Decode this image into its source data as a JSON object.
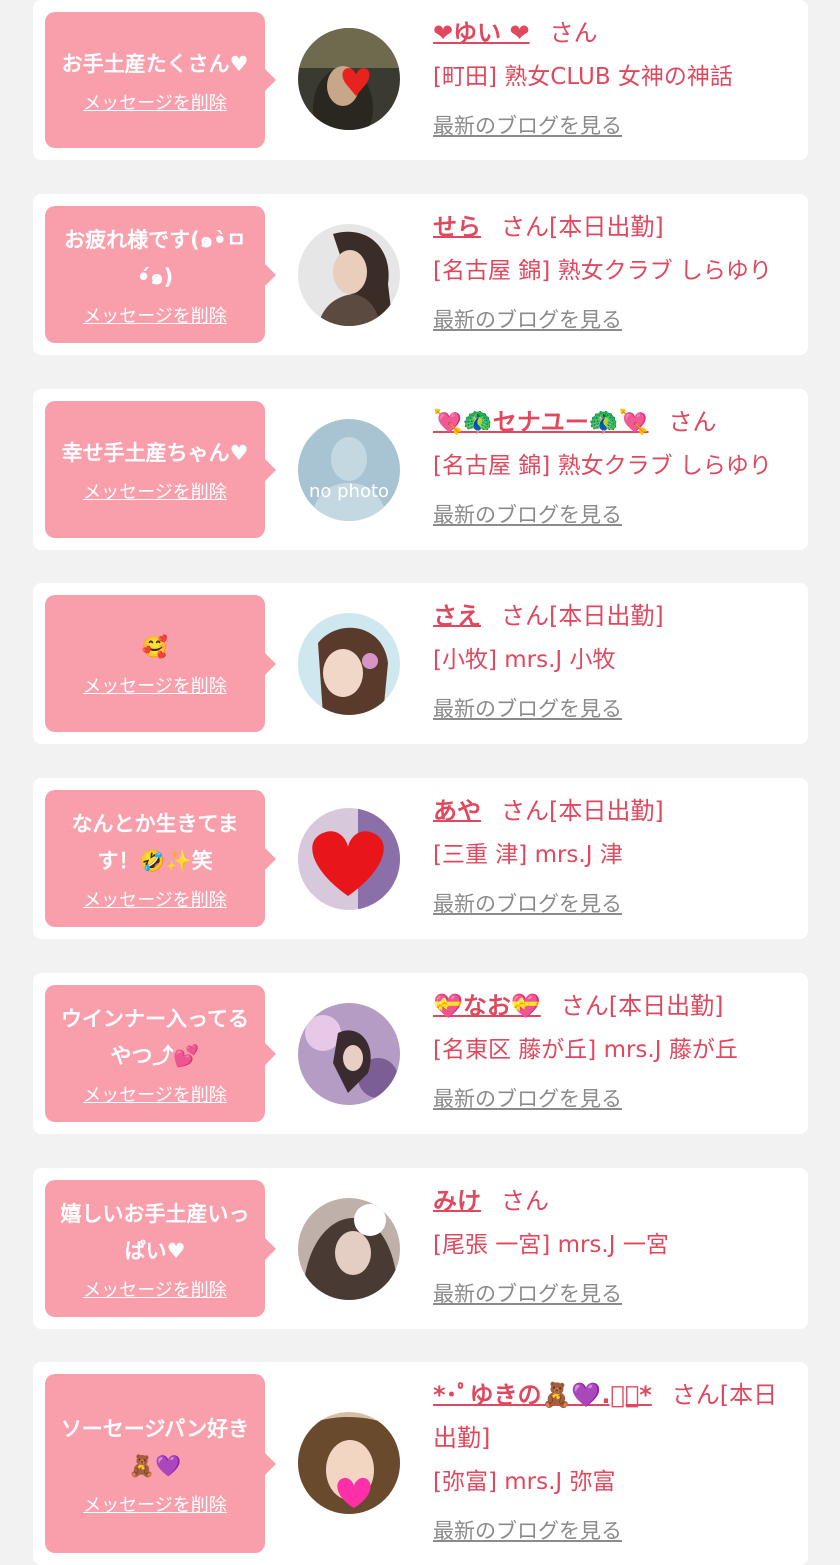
{
  "delete_label": "メッセージを削除",
  "blog_label": "最新のブログを見る",
  "items": [
    {
      "message": "お手土産たくさん♥",
      "name": "❤ゆい ❤",
      "suffix": "さん",
      "shop": "[町田] 熟女CLUB 女神の神話"
    },
    {
      "message": "お疲れ様です(๑•̀ㅁ•́๑)",
      "name": "せら",
      "suffix": "さん[本日出勤]",
      "shop": "[名古屋 錦] 熟女クラブ しらゆり"
    },
    {
      "message": "幸せ手土産ちゃん♥",
      "name": "💘🦚セナユー🦚💘",
      "suffix": "さん",
      "shop": "[名古屋 錦] 熟女クラブ しらゆり"
    },
    {
      "message": "🥰",
      "name": "さえ",
      "suffix": "さん[本日出勤]",
      "shop": "[小牧] mrs.J 小牧"
    },
    {
      "message": "なんとか生きてます！🤣✨笑",
      "name": "あや",
      "suffix": "さん[本日出勤]",
      "shop": "[三重 津] mrs.J 津"
    },
    {
      "message": "ウインナー入ってるやつ⤴💕",
      "name": "💝なお💝",
      "suffix": "さん[本日出勤]",
      "shop": "[名東区 藤が丘] mrs.J 藤が丘"
    },
    {
      "message": "嬉しいお手土産いっぱい♥",
      "name": "みけ",
      "suffix": "さん",
      "shop": "[尾張 一宮] mrs.J 一宮"
    },
    {
      "message": "ソーセージパン好き🧸💜",
      "name": "*･ﾟゆきの🧸💜.ﾟ･*",
      "suffix": "さん[本日出勤]",
      "shop": "[弥富] mrs.J 弥富"
    }
  ],
  "no_photo_text": "no photo"
}
